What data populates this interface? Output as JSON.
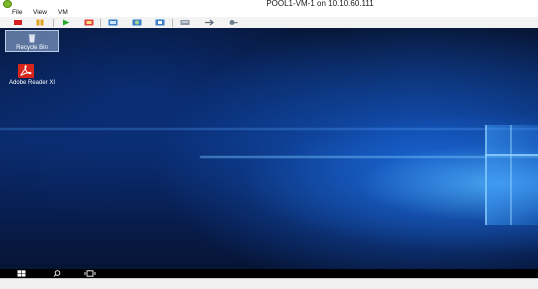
{
  "window": {
    "title": "POOL1-VM-1 on 10.10.60.111",
    "icon": "xencenter-console-icon"
  },
  "menubar": {
    "items": [
      {
        "label": "File"
      },
      {
        "label": "View"
      },
      {
        "label": "VM"
      }
    ]
  },
  "toolbar": {
    "buttons": [
      {
        "icon": "stop-icon"
      },
      {
        "icon": "pause-icon"
      },
      {
        "icon": "play-icon"
      },
      {
        "icon": "reset-icon"
      },
      {
        "icon": "snapshot-icon"
      },
      {
        "icon": "revert-icon"
      },
      {
        "icon": "manage-snapshots-icon"
      },
      {
        "icon": "send-keys-icon"
      },
      {
        "icon": "usb-icon"
      },
      {
        "icon": "settings-icon"
      }
    ]
  },
  "desktop": {
    "icons": [
      {
        "label": "Recycle Bin",
        "icon": "recycle-bin-icon",
        "selected": true
      },
      {
        "label": "Adobe Reader XI",
        "icon": "adobe-reader-icon"
      }
    ],
    "colors": {
      "wallpaper_dark": "#0a2a6a",
      "wallpaper_light": "#4fb0ff"
    }
  },
  "taskbar": {
    "items": [
      {
        "icon": "windows-start-icon"
      },
      {
        "icon": "search-icon"
      },
      {
        "icon": "task-view-icon"
      }
    ]
  }
}
